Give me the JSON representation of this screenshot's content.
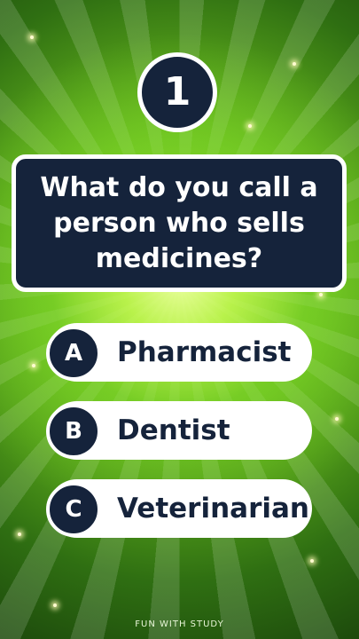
{
  "question_number": "1",
  "question": "What do you call a person who sells medicines?",
  "options": [
    {
      "letter": "A",
      "text": "Pharmacist"
    },
    {
      "letter": "B",
      "text": "Dentist"
    },
    {
      "letter": "C",
      "text": "Veterinarian"
    }
  ],
  "footer": "FUN WITH STUDY",
  "colors": {
    "badge": "#15233b",
    "background_center": "#b6f03a",
    "background_edge": "#1d4a0c",
    "option_background": "#ffffff"
  }
}
